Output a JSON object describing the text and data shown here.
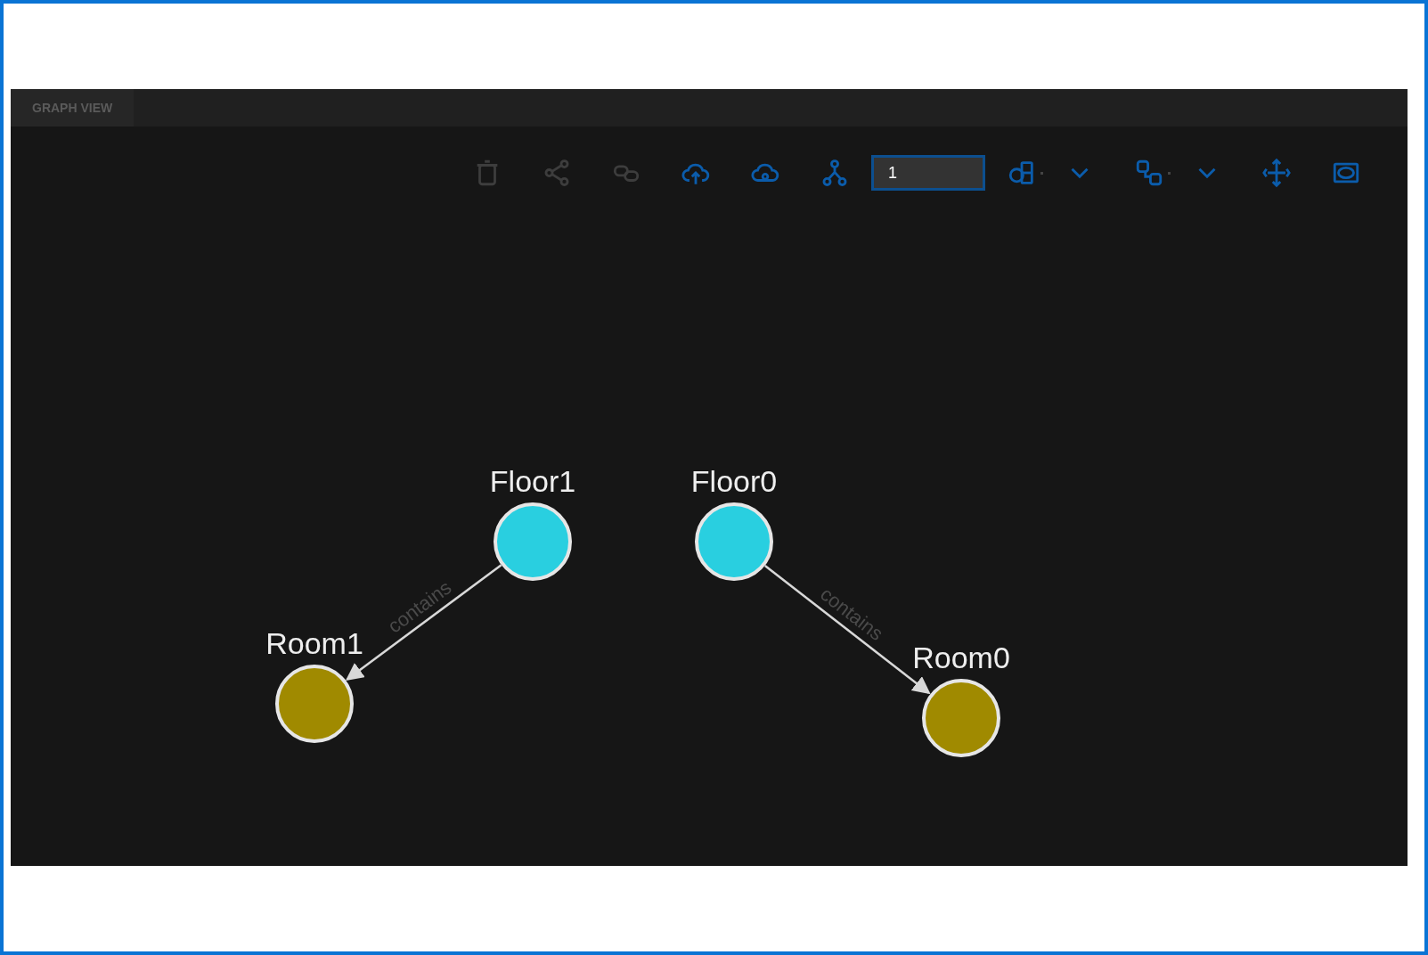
{
  "tab": {
    "label": "GRAPH VIEW",
    "selected": true
  },
  "toolbar": [
    {
      "kind": "trash",
      "disabled": true
    },
    {
      "kind": "share",
      "disabled": true
    },
    {
      "kind": "link",
      "disabled": true
    },
    {
      "kind": "upload",
      "disabled": false
    },
    {
      "kind": "cloud",
      "disabled": false
    },
    {
      "kind": "hierarchy",
      "disabled": false
    },
    {
      "kind": "input",
      "value": "1"
    },
    {
      "kind": "layout",
      "disabled": false
    },
    {
      "kind": "dropdown",
      "disabled": false
    },
    {
      "kind": "layout2",
      "disabled": false
    },
    {
      "kind": "dropdown",
      "disabled": false
    },
    {
      "kind": "move",
      "disabled": false
    },
    {
      "kind": "screen",
      "disabled": false
    }
  ],
  "nodes": [
    {
      "label": "Floor1",
      "color": "#29cfe0"
    },
    {
      "label": "Floor0",
      "color": "#29cfe0"
    },
    {
      "label": "Room1",
      "color": "#a08a00"
    },
    {
      "label": "Room0",
      "color": "#a08a00"
    }
  ],
  "edges": [
    {
      "label": "contains"
    },
    {
      "label": "contains"
    }
  ]
}
